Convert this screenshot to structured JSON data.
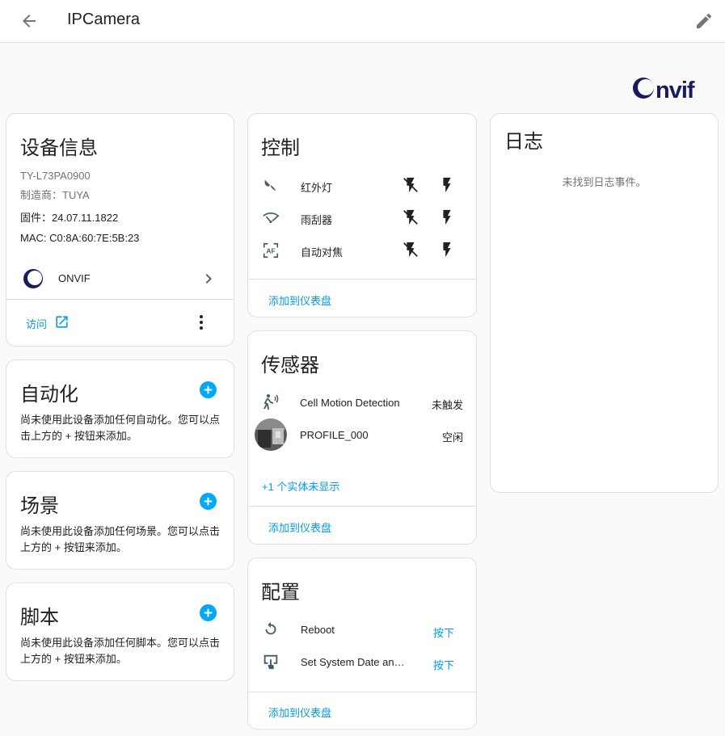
{
  "header": {
    "title": "IPCamera"
  },
  "device_info": {
    "title": "设备信息",
    "model": "TY-L73PA0900",
    "manufacturer": "制造商：TUYA",
    "firmware": "固件：24.07.11.1822",
    "mac": "MAC: C0:8A:60:7E:5B:23",
    "integration": "ONVIF",
    "visit": "访问"
  },
  "onvif_logo": {
    "text": "ONVIF"
  },
  "automation": {
    "title": "自动化",
    "description": "尚未使用此设备添加任何自动化。您可以点击上方的 + 按钮来添加。"
  },
  "scenes": {
    "title": "场景",
    "description": "尚未使用此设备添加任何场景。您可以点击上方的 + 按钮来添加。"
  },
  "scripts": {
    "title": "脚本",
    "description": "尚未使用此设备添加任何脚本。您可以点击上方的 + 按钮来添加。"
  },
  "controls": {
    "title": "控制",
    "items": [
      {
        "label": "红外灯",
        "icon": "infrared-light-icon"
      },
      {
        "label": "雨刮器",
        "icon": "wiper-icon"
      },
      {
        "label": "自动对焦",
        "icon": "autofocus-icon"
      }
    ],
    "add_to_dashboard": "添加到仪表盘"
  },
  "sensors": {
    "title": "传感器",
    "items": [
      {
        "label": "Cell Motion Detection",
        "state": "未触发"
      },
      {
        "label": "PROFILE_000",
        "state": "空闲"
      }
    ],
    "hidden_entities": "+1 个实体未显示",
    "add_to_dashboard": "添加到仪表盘"
  },
  "config": {
    "title": "配置",
    "items": [
      {
        "label": "Reboot",
        "action": "按下"
      },
      {
        "label": "Set System Date an…",
        "action": "按下"
      }
    ],
    "add_to_dashboard": "添加到仪表盘"
  },
  "logbook": {
    "title": "日志",
    "empty": "未找到日志事件。"
  },
  "colors": {
    "accent": "#039be5",
    "plus": "#03a9f4",
    "text": "#212121",
    "muted": "#727272"
  }
}
